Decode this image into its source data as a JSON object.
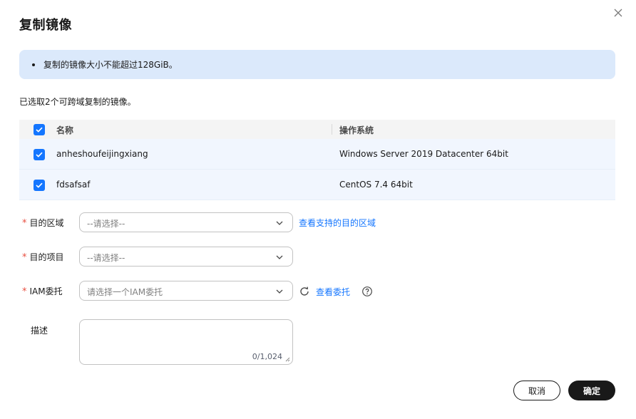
{
  "dialog": {
    "title": "复制镜像"
  },
  "notice": {
    "text": "复制的镜像大小不能超过128GiB。"
  },
  "selected_text": "已选取2个可跨域复制的镜像。",
  "table": {
    "headers": {
      "name": "名称",
      "os": "操作系统"
    },
    "rows": [
      {
        "name": "anheshoufeijingxiang",
        "os": "Windows Server 2019 Datacenter 64bit"
      },
      {
        "name": "fdsafsaf",
        "os": "CentOS 7.4 64bit"
      }
    ]
  },
  "form": {
    "region": {
      "label": "目的区域",
      "placeholder": "--请选择--",
      "link": "查看支持的目的区域"
    },
    "project": {
      "label": "目的项目",
      "placeholder": "--请选择--"
    },
    "iam": {
      "label": "IAM委托",
      "placeholder": "请选择一个IAM委托",
      "link": "查看委托"
    },
    "description": {
      "label": "描述",
      "counter": "0/1,024"
    },
    "required_mark": "*"
  },
  "buttons": {
    "cancel": "取消",
    "ok": "确定"
  },
  "colors": {
    "accent": "#1476ff",
    "notice_bg": "#dbe9fb",
    "required": "#e84e40",
    "primary_button": "#191919"
  }
}
